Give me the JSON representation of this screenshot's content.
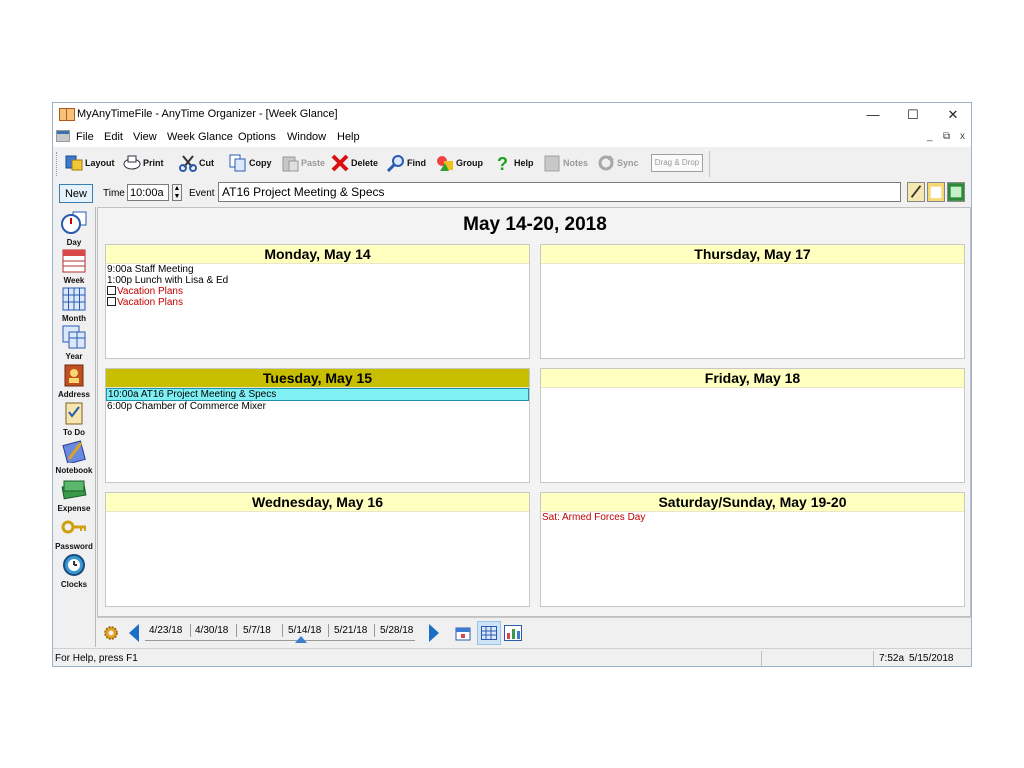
{
  "window": {
    "title": "MyAnyTimeFile - AnyTime Organizer - [Week Glance]",
    "minimize": "—",
    "maximize": "☐",
    "close": "✕"
  },
  "menu": {
    "items": [
      "File",
      "Edit",
      "View",
      "Week Glance",
      "Options",
      "Window",
      "Help"
    ],
    "mdi_min": "_",
    "mdi_restore": "⧉",
    "mdi_close": "x"
  },
  "toolbar": {
    "layout": "Layout",
    "print": "Print",
    "cut": "Cut",
    "copy": "Copy",
    "paste": "Paste",
    "delete": "Delete",
    "find": "Find",
    "group": "Group",
    "help": "Help",
    "notes": "Notes",
    "sync": "Sync",
    "drag_drop": "Drag & Drop"
  },
  "entry": {
    "new_label": "New",
    "time_label": "Time",
    "time_value": "10:00a",
    "event_label": "Event",
    "event_value": "AT16 Project Meeting & Specs"
  },
  "sidebar": {
    "items": [
      "Day",
      "Week",
      "Month",
      "Year",
      "Address",
      "To Do",
      "Notebook",
      "Expense",
      "Password",
      "Clocks"
    ]
  },
  "week": {
    "range_title": "May 14-20, 2018",
    "days": [
      {
        "header": "Monday, May 14",
        "events": [
          {
            "text": "9:00a Staff Meeting"
          },
          {
            "text": "1:00p Lunch with Lisa & Ed"
          }
        ],
        "tasks": [
          "Vacation Plans",
          "Vacation Plans"
        ]
      },
      {
        "header": "Tuesday, May 15",
        "events": [
          {
            "text": "10:00a AT16 Project Meeting & Specs"
          },
          {
            "text": "6:00p Chamber of Commerce Mixer"
          }
        ]
      },
      {
        "header": "Wednesday, May 16",
        "events": []
      },
      {
        "header": "Thursday, May 17",
        "events": []
      },
      {
        "header": "Friday, May 18",
        "events": []
      },
      {
        "header": "Saturday/Sunday, May 19-20",
        "events": [
          {
            "text": "Sat: Armed Forces Day"
          }
        ]
      }
    ]
  },
  "weeknav": {
    "weeks": [
      "4/23/18",
      "4/30/18",
      "5/7/18",
      "5/14/18",
      "5/21/18",
      "5/28/18"
    ],
    "selected": "5/14/18"
  },
  "status": {
    "help_text": "For Help, press F1",
    "time": "7:52a",
    "date": "5/15/2018"
  },
  "colors": {
    "day_header": "#ffffc0",
    "selected_day_header": "#c8be00",
    "highlight_event": "#7ff0f4",
    "holiday_text": "#c00000",
    "nav_accent": "#1a6fc4"
  }
}
